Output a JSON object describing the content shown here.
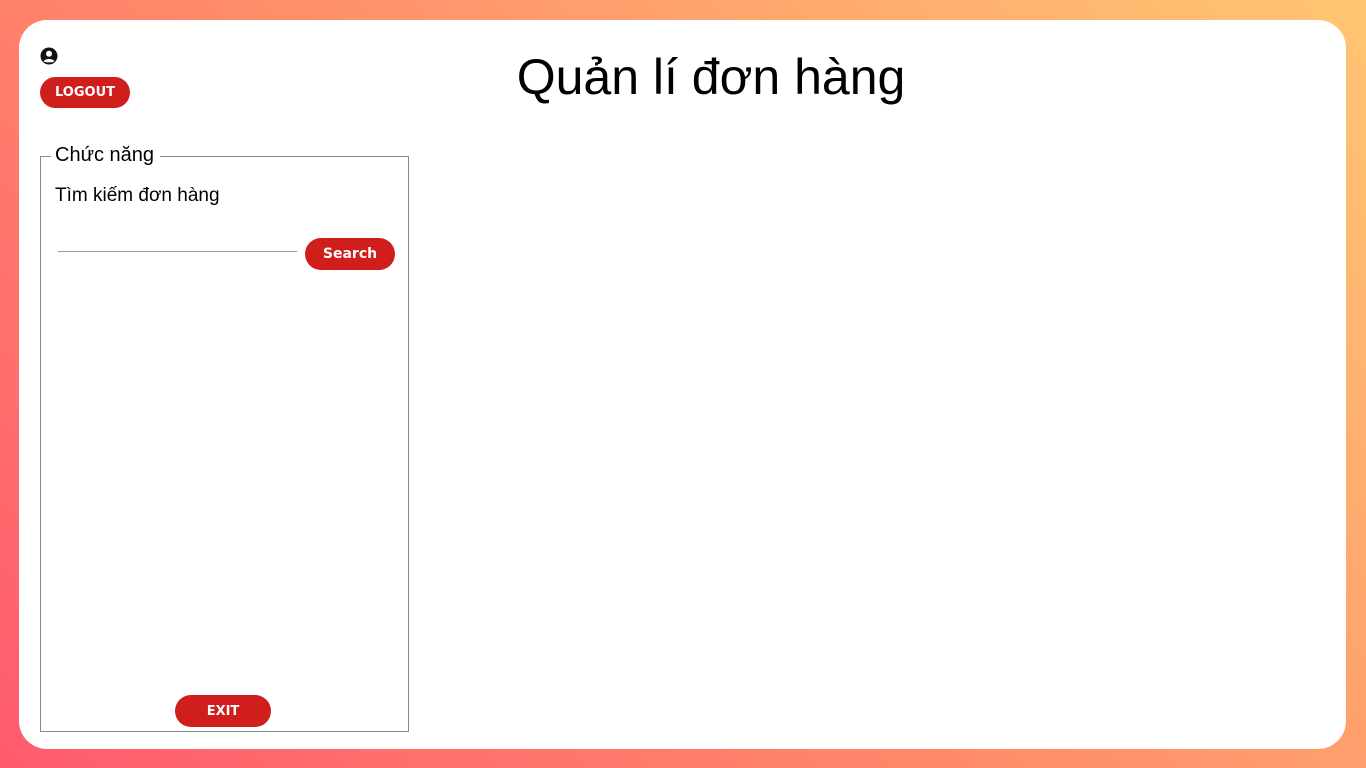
{
  "header": {
    "user_icon": "user-circle-icon",
    "logout_label": "LOGOUT",
    "title": "Quản lí đơn hàng"
  },
  "panel": {
    "legend": "Chức năng",
    "search_label": "Tìm kiếm đơn hàng",
    "search_value": "",
    "search_placeholder": "",
    "search_button": "Search",
    "exit_button": "EXIT"
  },
  "colors": {
    "accent": "#cf1e1b",
    "gradient_start": "#ff5a6e",
    "gradient_end": "#ffc672"
  }
}
